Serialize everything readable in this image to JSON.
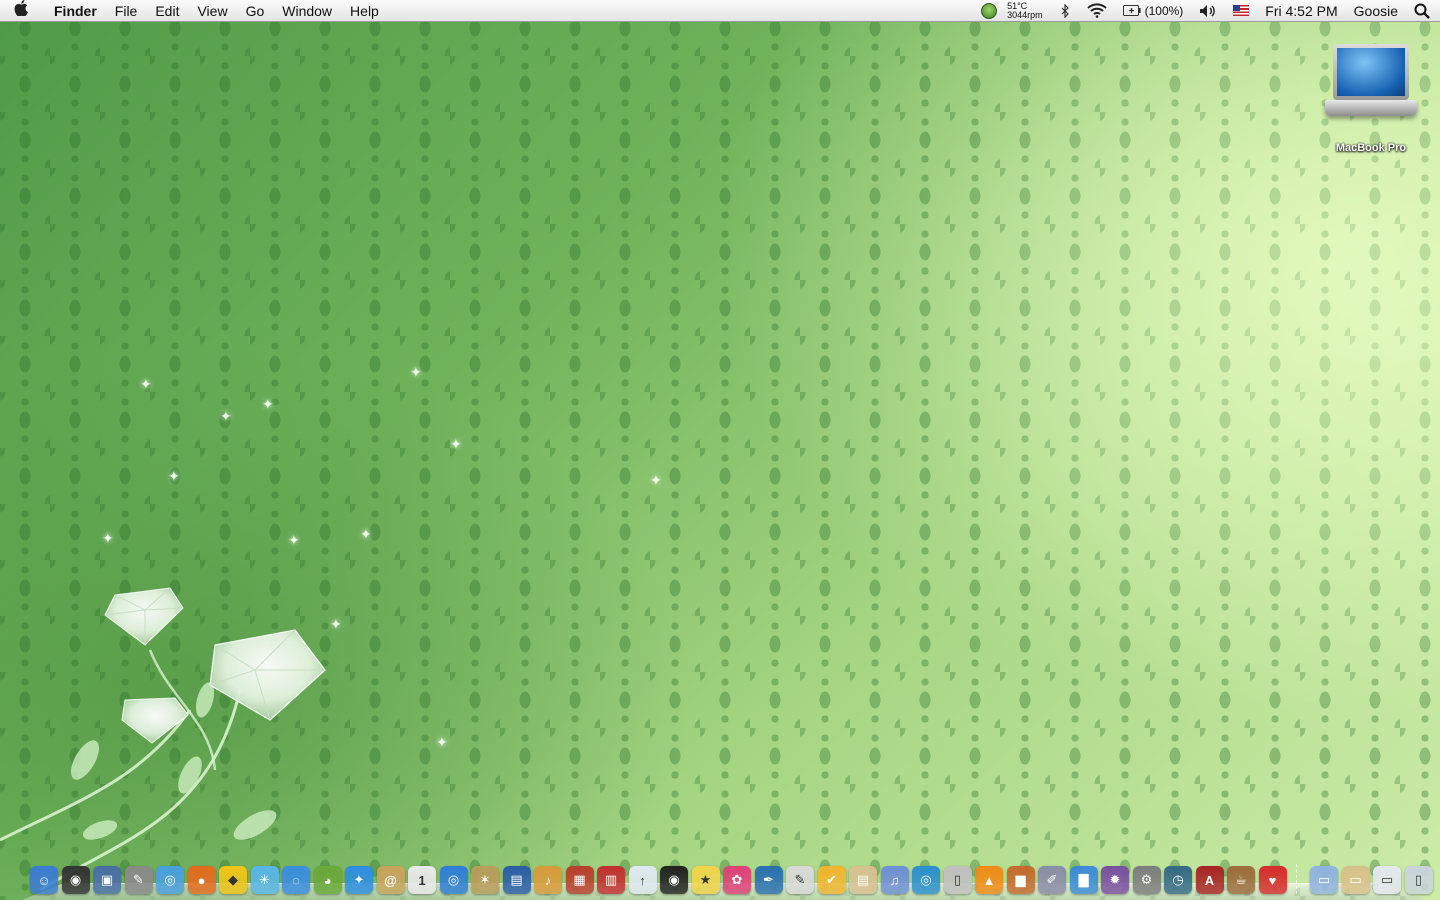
{
  "menubar": {
    "apple_icon": "apple-logo-icon",
    "app_name": "Finder",
    "menus": [
      "File",
      "Edit",
      "View",
      "Go",
      "Window",
      "Help"
    ],
    "status": {
      "temperature": "51°C",
      "fan_speed": "3044rpm",
      "battery": "(100%)",
      "clock": "Fri 4:52 PM",
      "user": "Goosie"
    }
  },
  "desktop": {
    "icons": [
      {
        "label": "MacBook Pro",
        "icon": "laptop-icon"
      }
    ]
  },
  "dock": {
    "apps": [
      {
        "name": "finder",
        "color": "#3a7bd5",
        "glyph": "☺"
      },
      {
        "name": "dashboard",
        "color": "#333333",
        "glyph": "◉"
      },
      {
        "name": "preview",
        "color": "#4a6fa5",
        "glyph": "▣"
      },
      {
        "name": "utilities",
        "color": "#8a8a8a",
        "glyph": "✎"
      },
      {
        "name": "safari",
        "color": "#4aa0e0",
        "glyph": "◎"
      },
      {
        "name": "firefox",
        "color": "#e46b1f",
        "glyph": "●"
      },
      {
        "name": "adium",
        "color": "#f0c419",
        "glyph": "◆"
      },
      {
        "name": "network",
        "color": "#58b6e6",
        "glyph": "✳"
      },
      {
        "name": "ichat",
        "color": "#3b8de0",
        "glyph": "◌"
      },
      {
        "name": "frog-app",
        "color": "#6aa83a",
        "glyph": "◕"
      },
      {
        "name": "messenger",
        "color": "#2f8ee0",
        "glyph": "✦"
      },
      {
        "name": "address-book",
        "color": "#c9a35c",
        "glyph": "@"
      },
      {
        "name": "ical",
        "color": "#e9e9e9",
        "glyph": "1"
      },
      {
        "name": "iphoto-disc",
        "color": "#2f7ed6",
        "glyph": "◎"
      },
      {
        "name": "compass-app",
        "color": "#b89c5a",
        "glyph": "✶"
      },
      {
        "name": "imovie",
        "color": "#2b5ea8",
        "glyph": "▤"
      },
      {
        "name": "garageband",
        "color": "#d99a3b",
        "glyph": "♪"
      },
      {
        "name": "photo-booth",
        "color": "#b93f2c",
        "glyph": "▦"
      },
      {
        "name": "photo-app",
        "color": "#c23030",
        "glyph": "▥"
      },
      {
        "name": "flickr-uploader",
        "color": "#dfe7f2",
        "glyph": "↑"
      },
      {
        "name": "camera-lens",
        "color": "#222222",
        "glyph": "◉"
      },
      {
        "name": "star-app",
        "color": "#f0d34a",
        "glyph": "★"
      },
      {
        "name": "flower-app",
        "color": "#e0407a",
        "glyph": "✿"
      },
      {
        "name": "pen-app",
        "color": "#2a6fb0",
        "glyph": "✒"
      },
      {
        "name": "textedit",
        "color": "#d8d8d8",
        "glyph": "✎"
      },
      {
        "name": "twitter-app",
        "color": "#f1b52f",
        "glyph": "✔"
      },
      {
        "name": "notes-app",
        "color": "#d8c090",
        "glyph": "▤"
      },
      {
        "name": "itunes",
        "color": "#6e8fd6",
        "glyph": "♫"
      },
      {
        "name": "search-app",
        "color": "#2b8fd0",
        "glyph": "◎"
      },
      {
        "name": "hard-disk",
        "color": "#bfbfbf",
        "glyph": "▯"
      },
      {
        "name": "vlc",
        "color": "#f08b16",
        "glyph": "▲"
      },
      {
        "name": "keynote",
        "color": "#c46a2c",
        "glyph": "▆"
      },
      {
        "name": "pencil-app",
        "color": "#8a8ca8",
        "glyph": "✐"
      },
      {
        "name": "chart-app",
        "color": "#3d8bd6",
        "glyph": "▇"
      },
      {
        "name": "gear-app",
        "color": "#7a4fa0",
        "glyph": "✹"
      },
      {
        "name": "system-preferences",
        "color": "#7d7d7d",
        "glyph": "⚙"
      },
      {
        "name": "time-machine",
        "color": "#356a86",
        "glyph": "◷"
      },
      {
        "name": "dictionary",
        "color": "#a82424",
        "glyph": "A"
      },
      {
        "name": "coffee-app",
        "color": "#9b6b3a",
        "glyph": "☕"
      },
      {
        "name": "red-app",
        "color": "#d62b2b",
        "glyph": "♥"
      }
    ],
    "folders": [
      {
        "name": "applications-folder",
        "color": "#8fb2e0",
        "glyph": "▭"
      },
      {
        "name": "documents-folder",
        "color": "#d8c08a",
        "glyph": "▭"
      },
      {
        "name": "downloads-folder",
        "color": "#e3e7ee",
        "glyph": "▭"
      },
      {
        "name": "trash",
        "color": "#c9d3dc",
        "glyph": "▯"
      }
    ]
  }
}
